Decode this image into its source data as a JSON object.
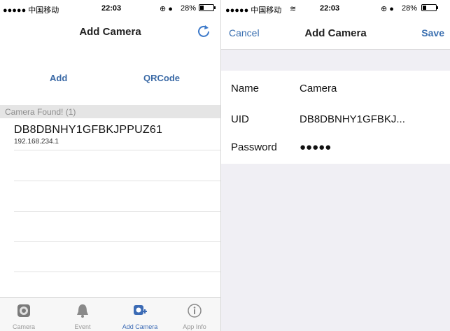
{
  "left": {
    "status": {
      "carrier": "●●●●● 中国移动",
      "time": "22:03",
      "battery": "28%",
      "battery_level": 0.28
    },
    "nav": {
      "title": "Add Camera"
    },
    "buttons": {
      "add": "Add",
      "qrcode": "QRCode"
    },
    "found_header": "Camera Found! (1)",
    "devices": [
      {
        "uid": "DB8DBNHY1GFBKJPPUZ61",
        "ip": "192.168.234.1"
      }
    ],
    "tabs": [
      {
        "label": "Camera",
        "icon": "camera-icon"
      },
      {
        "label": "Event",
        "icon": "bell-icon"
      },
      {
        "label": "Add Camera",
        "icon": "add-camera-icon"
      },
      {
        "label": "App Info",
        "icon": "info-icon"
      }
    ],
    "accent": "#3c6bb5"
  },
  "right": {
    "status": {
      "carrier": "●●●●● 中国移动",
      "time": "22:03",
      "battery": "28%",
      "battery_level": 0.28
    },
    "nav": {
      "cancel": "Cancel",
      "title": "Add Camera",
      "save": "Save"
    },
    "form": {
      "name_label": "Name",
      "name_value": "Camera",
      "uid_label": "UID",
      "uid_value": "DB8DBNHY1GFBKJ...",
      "password_label": "Password",
      "password_value": "●●●●●"
    }
  }
}
